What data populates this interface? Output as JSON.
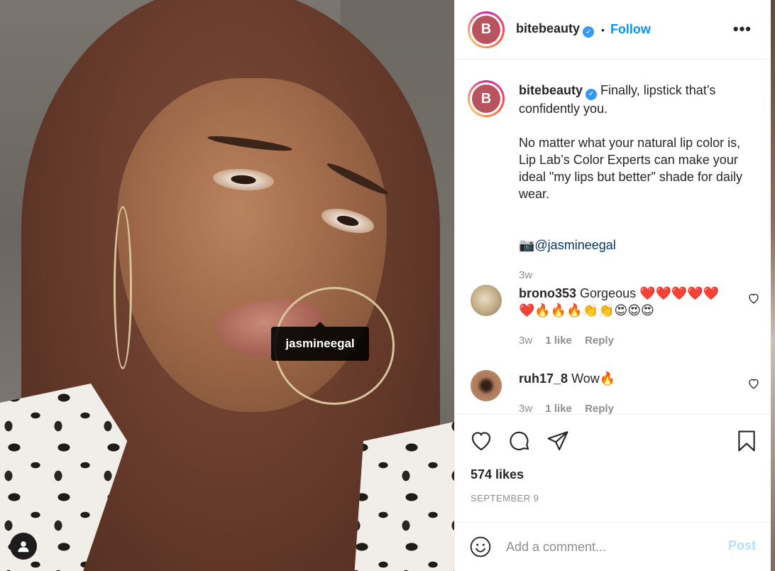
{
  "photo": {
    "tag_label": "jasmineegal",
    "tag_icon": "user-icon"
  },
  "header": {
    "username": "bitebeauty",
    "avatar_letter": "B",
    "verified_icon": "verified-badge-icon",
    "separator": "•",
    "follow_label": "Follow",
    "more_label": "•••"
  },
  "caption": {
    "username": "bitebeauty",
    "line1": "Finally, lipstick that’s confidently you.",
    "body": "No matter what your natural lip color is, Lip Lab’s Color Experts can make your ideal \"my lips but better\" shade for daily wear.",
    "mention": "📷@jasmineegal",
    "time": "3w"
  },
  "comments": [
    {
      "username": "brono353",
      "text": "Gorgeous ❤️❤️❤️❤️❤️❤️🔥🔥🔥👏👏😍😍😍",
      "time": "3w",
      "likes": "1 like",
      "reply": "Reply"
    },
    {
      "username": "ruh17_8",
      "text": "Wow🔥",
      "time": "3w",
      "likes": "1 like",
      "reply": "Reply"
    }
  ],
  "actions": {
    "like_icon": "heart-icon",
    "comment_icon": "comment-icon",
    "share_icon": "paper-plane-icon",
    "save_icon": "bookmark-icon",
    "likes": "574 likes",
    "date": "SEPTEMBER 9"
  },
  "add_comment": {
    "placeholder": "Add a comment...",
    "post_label": "Post",
    "emoji_icon": "smiley-icon"
  },
  "colors": {
    "follow": "#0095f6",
    "post_disabled": "#b2dffc",
    "mention": "#00376b",
    "brand_logo": "#b8545d"
  }
}
